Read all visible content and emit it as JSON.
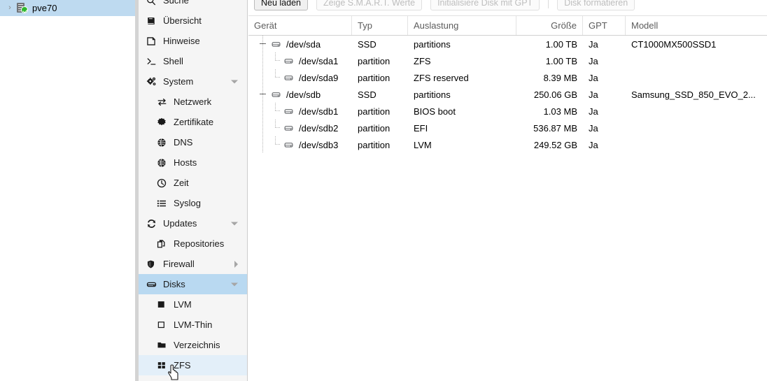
{
  "tree": {
    "items": [
      {
        "label": "pve70",
        "icon": "server-ok-icon",
        "expander": "›"
      }
    ]
  },
  "nav": {
    "items": [
      {
        "label": "Suche",
        "icon": "search-icon",
        "level": 0,
        "state": "normal",
        "chevron": "none"
      },
      {
        "label": "Übersicht",
        "icon": "book-icon",
        "level": 0,
        "state": "normal",
        "chevron": "none"
      },
      {
        "label": "Hinweise",
        "icon": "note-icon",
        "level": 0,
        "state": "normal",
        "chevron": "none"
      },
      {
        "label": "Shell",
        "icon": "terminal-icon",
        "level": 0,
        "state": "normal",
        "chevron": "none"
      },
      {
        "label": "System",
        "icon": "gears-icon",
        "level": 0,
        "state": "normal",
        "chevron": "down"
      },
      {
        "label": "Netzwerk",
        "icon": "exchange-icon",
        "level": 1,
        "state": "normal",
        "chevron": "none"
      },
      {
        "label": "Zertifikate",
        "icon": "certificate-icon",
        "level": 1,
        "state": "normal",
        "chevron": "none"
      },
      {
        "label": "DNS",
        "icon": "globe-icon",
        "level": 1,
        "state": "normal",
        "chevron": "none"
      },
      {
        "label": "Hosts",
        "icon": "globe-icon",
        "level": 1,
        "state": "normal",
        "chevron": "none"
      },
      {
        "label": "Zeit",
        "icon": "clock-icon",
        "level": 1,
        "state": "normal",
        "chevron": "none"
      },
      {
        "label": "Syslog",
        "icon": "list-icon",
        "level": 1,
        "state": "normal",
        "chevron": "none"
      },
      {
        "label": "Updates",
        "icon": "refresh-icon",
        "level": 0,
        "state": "normal",
        "chevron": "down"
      },
      {
        "label": "Repositories",
        "icon": "copy-icon",
        "level": 1,
        "state": "normal",
        "chevron": "none"
      },
      {
        "label": "Firewall",
        "icon": "shield-icon",
        "level": 0,
        "state": "normal",
        "chevron": "right"
      },
      {
        "label": "Disks",
        "icon": "disk-icon",
        "level": 0,
        "state": "selected",
        "chevron": "down"
      },
      {
        "label": "LVM",
        "icon": "square-filled-icon",
        "level": 1,
        "state": "normal",
        "chevron": "none"
      },
      {
        "label": "LVM-Thin",
        "icon": "square-outline-icon",
        "level": 1,
        "state": "normal",
        "chevron": "none"
      },
      {
        "label": "Verzeichnis",
        "icon": "folder-icon",
        "level": 1,
        "state": "normal",
        "chevron": "none"
      },
      {
        "label": "ZFS",
        "icon": "grid-icon",
        "level": 1,
        "state": "hover",
        "chevron": "none"
      }
    ]
  },
  "toolbar": {
    "buttons": [
      {
        "label": "Neu laden",
        "enabled": true,
        "separator_after": false
      },
      {
        "label": "Zeige S.M.A.R.T. Werte",
        "enabled": false,
        "separator_after": false
      },
      {
        "label": "Initialisiere Disk mit GPT",
        "enabled": false,
        "separator_after": true
      },
      {
        "label": "Disk formatieren",
        "enabled": false,
        "separator_after": false
      }
    ]
  },
  "grid": {
    "columns": [
      {
        "key": "device",
        "label": "Gerät",
        "align": "left"
      },
      {
        "key": "type",
        "label": "Typ",
        "align": "left"
      },
      {
        "key": "usage",
        "label": "Auslastung",
        "align": "left"
      },
      {
        "key": "size",
        "label": "Größe",
        "align": "right"
      },
      {
        "key": "gpt",
        "label": "GPT",
        "align": "left"
      },
      {
        "key": "model",
        "label": "Modell",
        "align": "left"
      }
    ],
    "rows": [
      {
        "device": "/dev/sda",
        "type": "SSD",
        "usage": "partitions",
        "size": "1.00 TB",
        "gpt": "Ja",
        "model": "CT1000MX500SSD1",
        "depth": 0,
        "expanded": true,
        "last": false
      },
      {
        "device": "/dev/sda1",
        "type": "partition",
        "usage": "ZFS",
        "size": "1.00 TB",
        "gpt": "Ja",
        "model": "",
        "depth": 1,
        "expanded": false,
        "last": false
      },
      {
        "device": "/dev/sda9",
        "type": "partition",
        "usage": "ZFS reserved",
        "size": "8.39 MB",
        "gpt": "Ja",
        "model": "",
        "depth": 1,
        "expanded": false,
        "last": true
      },
      {
        "device": "/dev/sdb",
        "type": "SSD",
        "usage": "partitions",
        "size": "250.06 GB",
        "gpt": "Ja",
        "model": "Samsung_SSD_850_EVO_2...",
        "depth": 0,
        "expanded": true,
        "last": false
      },
      {
        "device": "/dev/sdb1",
        "type": "partition",
        "usage": "BIOS boot",
        "size": "1.03 MB",
        "gpt": "Ja",
        "model": "",
        "depth": 1,
        "expanded": false,
        "last": false
      },
      {
        "device": "/dev/sdb2",
        "type": "partition",
        "usage": "EFI",
        "size": "536.87 MB",
        "gpt": "Ja",
        "model": "",
        "depth": 1,
        "expanded": false,
        "last": false
      },
      {
        "device": "/dev/sdb3",
        "type": "partition",
        "usage": "LVM",
        "size": "249.52 GB",
        "gpt": "Ja",
        "model": "",
        "depth": 1,
        "expanded": false,
        "last": true
      }
    ]
  },
  "colors": {
    "selected_row": "#b9d9f1",
    "hover_row": "#e3eff9",
    "sidebar_bg": "#f5f5f5",
    "status_ok": "#2eb82e",
    "header_text": "#5c5c5c"
  }
}
